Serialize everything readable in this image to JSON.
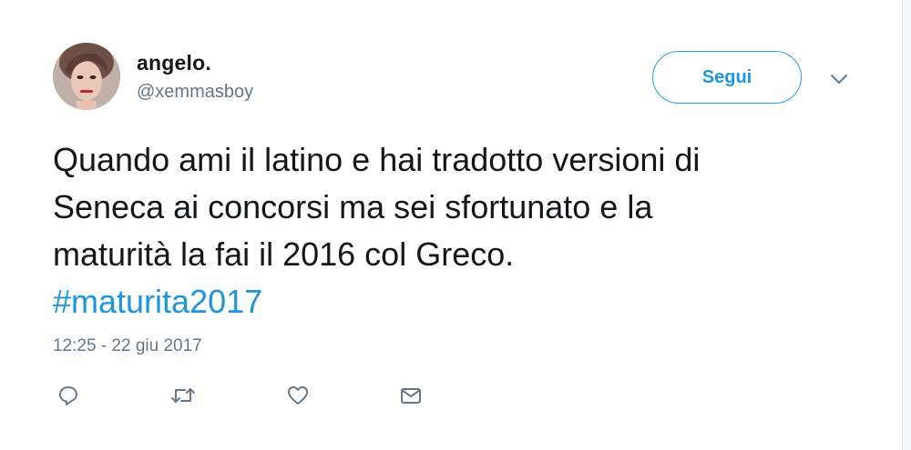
{
  "author": {
    "name": "angelo.",
    "handle": "@xemmasboy"
  },
  "follow_button": {
    "label": "Segui"
  },
  "tweet": {
    "lines": [
      "Quando ami il latino e hai tradotto versioni di",
      "Seneca ai concorsi ma sei sfortunato e la",
      "maturità la fai il 2016 col Greco."
    ],
    "hashtag": "#maturita2017",
    "timestamp": "12:25 - 22 giu 2017"
  },
  "icons": {
    "more": "chevron-down-icon",
    "reply": "reply-icon",
    "retweet": "retweet-icon",
    "like": "heart-icon",
    "message": "envelope-icon"
  },
  "colors": {
    "accent": "#1da1f2",
    "link": "#1b95e0",
    "text": "#14171a",
    "secondary": "#657786",
    "icon": "#657786"
  }
}
